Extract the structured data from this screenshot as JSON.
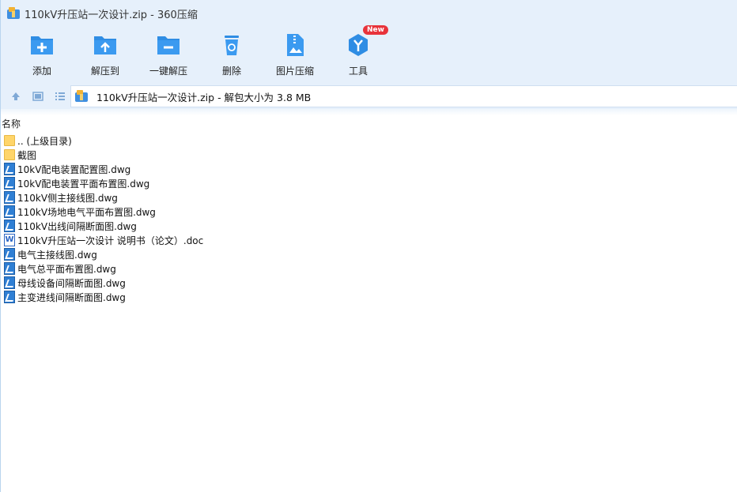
{
  "window": {
    "title": "110kV升压站一次设计.zip - 360压缩"
  },
  "toolbar": {
    "items": [
      {
        "label": "添加",
        "icon": "add-folder-icon"
      },
      {
        "label": "解压到",
        "icon": "extract-to-icon"
      },
      {
        "label": "一键解压",
        "icon": "one-click-extract-icon"
      },
      {
        "label": "删除",
        "icon": "delete-icon"
      },
      {
        "label": "图片压缩",
        "icon": "image-compress-icon"
      },
      {
        "label": "工具",
        "icon": "tools-icon",
        "badge": "New"
      }
    ]
  },
  "address": {
    "text": "110kV升压站一次设计.zip - 解包大小为 3.8 MB"
  },
  "list": {
    "column_name": "名称",
    "items": [
      {
        "name": ".. (上级目录)",
        "type": "folder"
      },
      {
        "name": "截图",
        "type": "folder"
      },
      {
        "name": "10kV配电装置配置图.dwg",
        "type": "dwg"
      },
      {
        "name": "10kV配电装置平面布置图.dwg",
        "type": "dwg"
      },
      {
        "name": "110kV侧主接线图.dwg",
        "type": "dwg"
      },
      {
        "name": "110kV场地电气平面布置图.dwg",
        "type": "dwg"
      },
      {
        "name": "110kV出线间隔断面图.dwg",
        "type": "dwg"
      },
      {
        "name": "110kV升压站一次设计 说明书（论文）.doc",
        "type": "doc"
      },
      {
        "name": "电气主接线图.dwg",
        "type": "dwg"
      },
      {
        "name": "电气总平面布置图.dwg",
        "type": "dwg"
      },
      {
        "name": "母线设备间隔断面图.dwg",
        "type": "dwg"
      },
      {
        "name": "主变进线间隔断面图.dwg",
        "type": "dwg"
      }
    ]
  },
  "colors": {
    "toolbar_bg": "#e6f0fb",
    "icon_blue": "#2f8de4",
    "badge_red": "#e8333b",
    "folder_yellow": "#ffd56a"
  }
}
